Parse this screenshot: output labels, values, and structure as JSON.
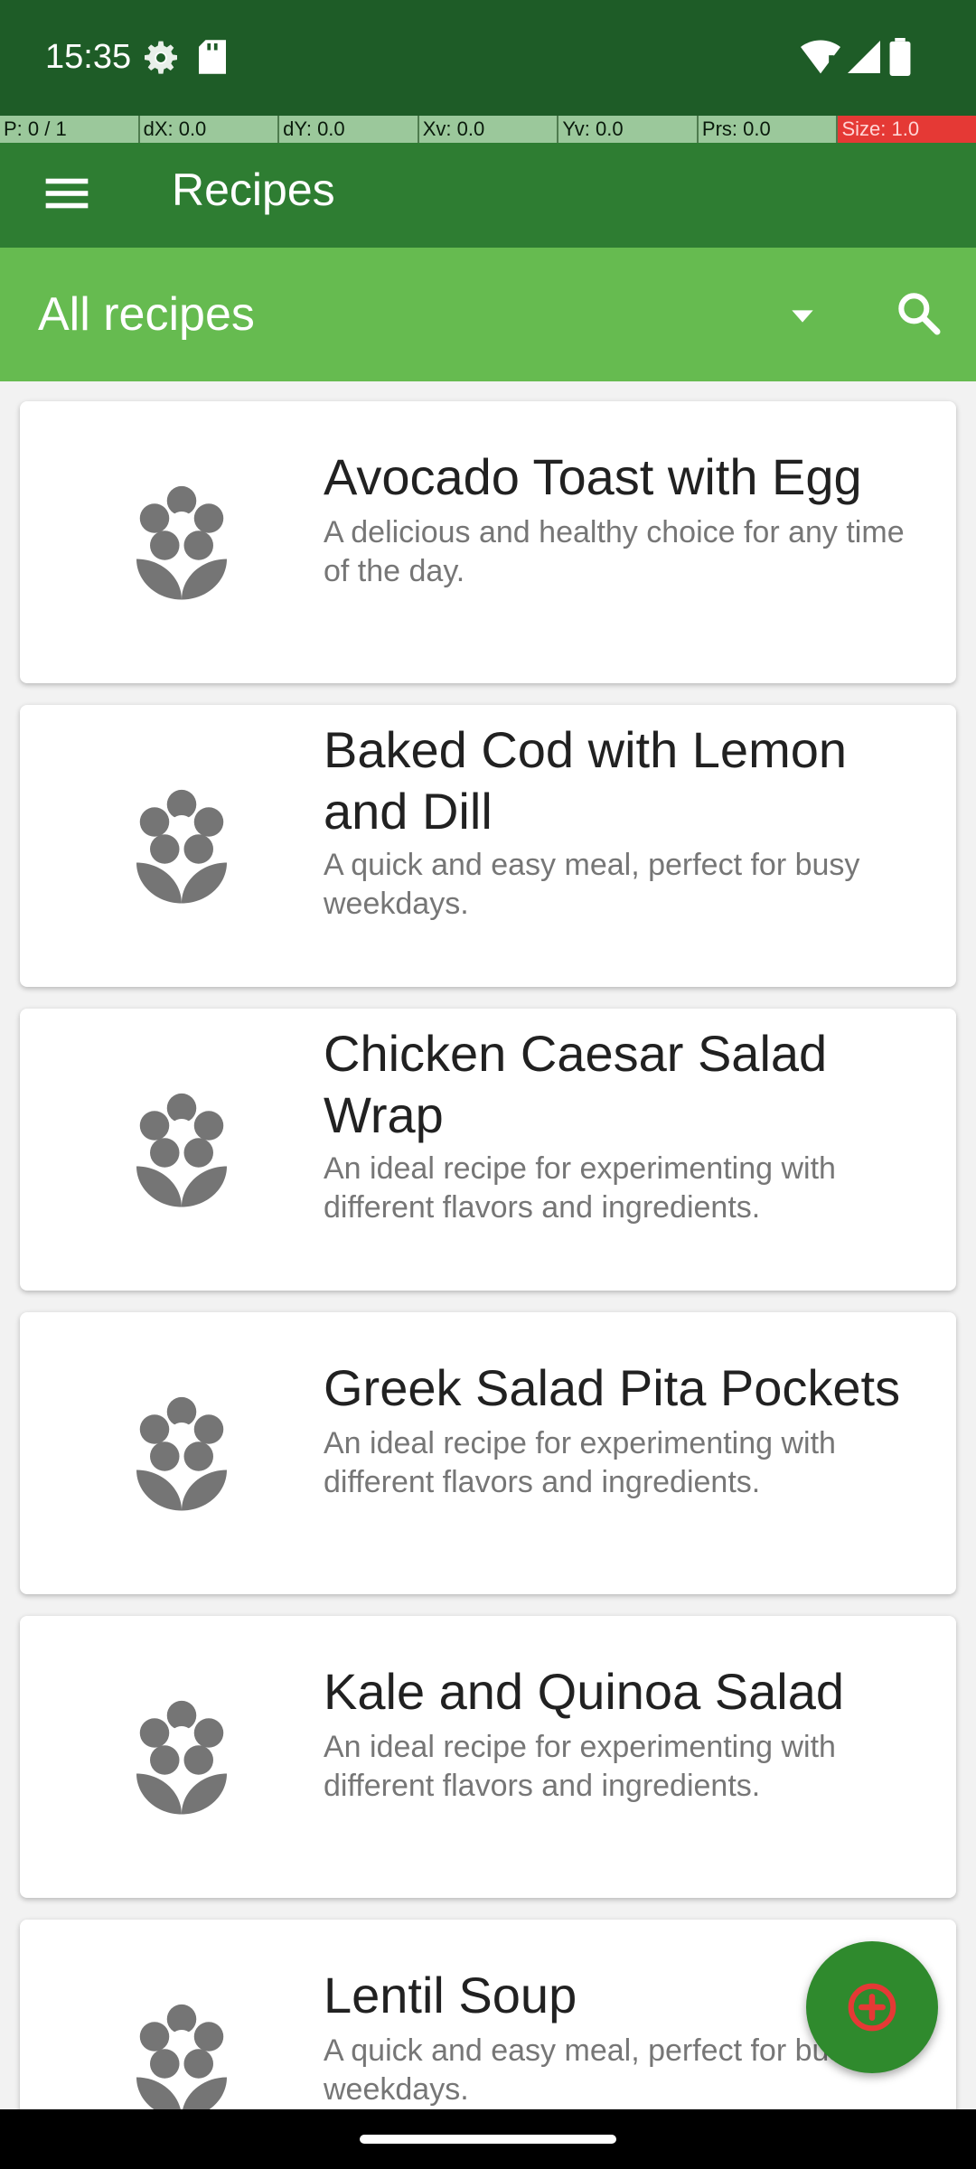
{
  "status_bar": {
    "time": "15:35",
    "icons": [
      "settings-icon",
      "sd-card-icon",
      "wifi-icon",
      "signal-icon",
      "battery-icon"
    ]
  },
  "debug_overlay": [
    "P: 0 / 1",
    "dX: 0.0",
    "dY: 0.0",
    "Xv: 0.0",
    "Yv: 0.0",
    "Prs: 0.0",
    "Size: 1.0"
  ],
  "app_bar": {
    "title": "Recipes",
    "menu_icon": "hamburger-menu-icon"
  },
  "filter_bar": {
    "selected": "All recipes",
    "dropdown_icon": "dropdown-arrow-icon",
    "search_icon": "search-icon"
  },
  "recipes": [
    {
      "title": "Avocado Toast with Egg",
      "description": "A delicious and healthy choice for any time of the day."
    },
    {
      "title": "Baked Cod with Lemon and Dill",
      "description": "A quick and easy meal, perfect for busy weekdays."
    },
    {
      "title": "Chicken Caesar Salad Wrap",
      "description": "An ideal recipe for experimenting with different flavors and ingredients."
    },
    {
      "title": "Greek Salad Pita Pockets",
      "description": "An ideal recipe for experimenting with different flavors and ingredients."
    },
    {
      "title": "Kale and Quinoa Salad",
      "description": "An ideal recipe for experimenting with different flavors and ingredients."
    },
    {
      "title": "Lentil Soup",
      "description": "A quick and easy meal, perfect for busy weekdays."
    }
  ],
  "fab": {
    "icon": "add-icon"
  },
  "colors": {
    "status_bar": "#1e5c27",
    "app_bar": "#2e7d32",
    "filter_bar": "#66bb50",
    "fab": "#2f8a2d",
    "fab_icon": "#e53935",
    "thumb_icon": "#757575"
  }
}
